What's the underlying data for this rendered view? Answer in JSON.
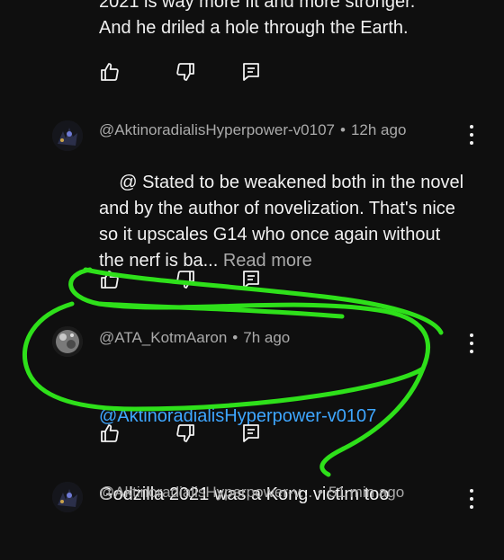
{
  "comments": [
    {
      "partial_text": "2021 is way more fit and more stronger.\nAnd he driled a hole through the Earth."
    },
    {
      "author": "@AktinoradialisHyperpower-v0107",
      "age": "12h ago",
      "text": "@ Stated to be weakened both in the novel and by the author of novelization. That's nice so it upscales G14 who once again without the nerf is ba...",
      "read_more": "Read more"
    },
    {
      "author": "@ATA_KotmAaron",
      "age": "7h ago",
      "mention": "@AktinoradialisHyperpower-v0107",
      "text": "Godzilla 2021 was a Kong victim too"
    },
    {
      "author": "@AktinoradialisHyperpower-v...",
      "age": "51 min ago"
    }
  ],
  "icons": {
    "like": "thumbs-up-icon",
    "dislike": "thumbs-down-icon",
    "reply": "reply-comment-icon",
    "more": "kebab-menu-icon"
  },
  "colors": {
    "background": "#0f0f0f",
    "text": "#f1f1f1",
    "secondary": "#aaaaaa",
    "mention": "#3ea6ff",
    "highlight_scribble": "#2ee01a"
  }
}
